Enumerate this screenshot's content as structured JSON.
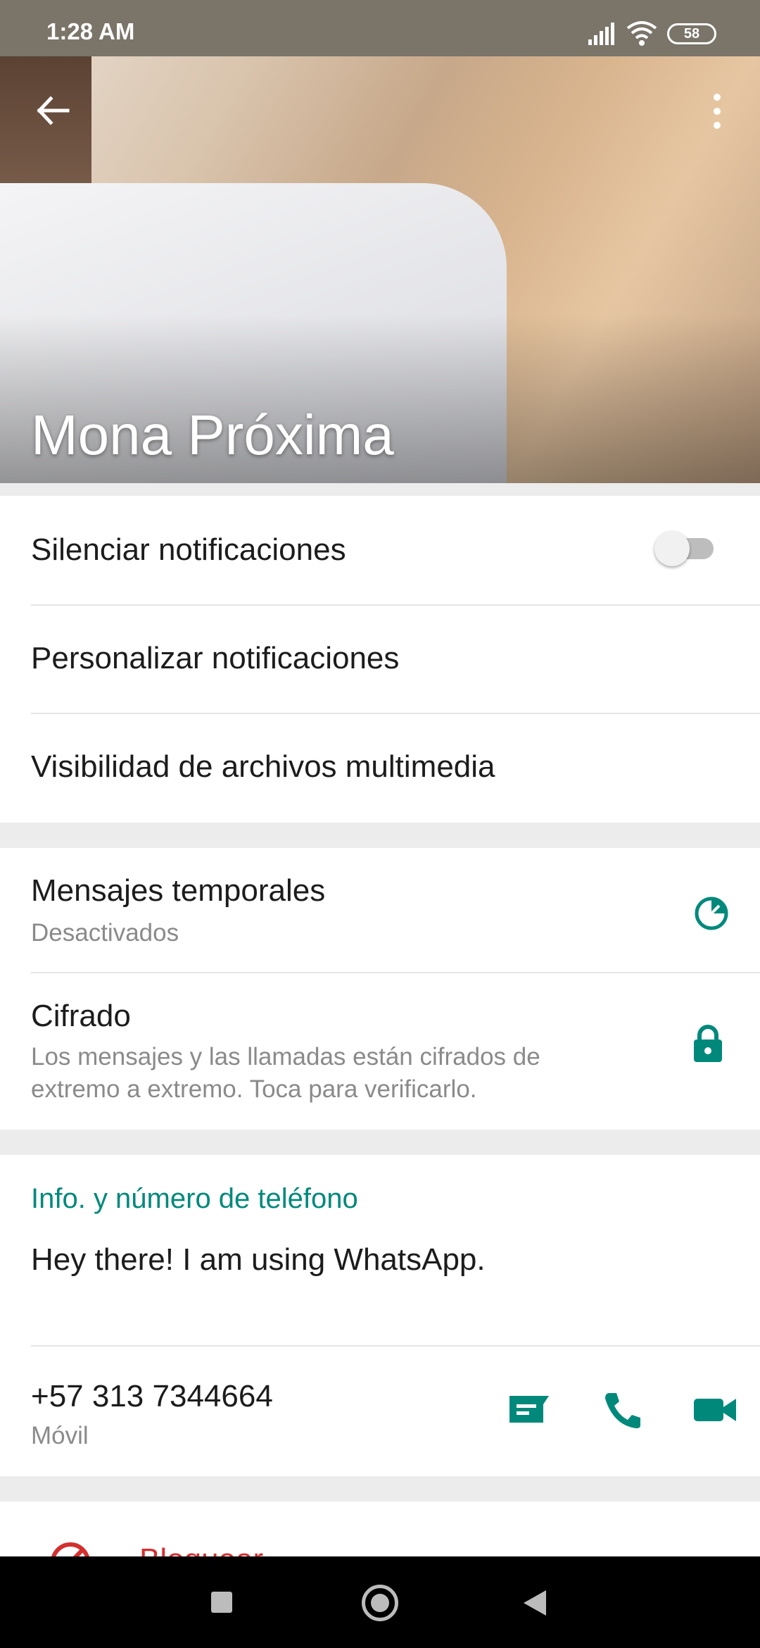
{
  "status_bar": {
    "time": "1:28 AM",
    "battery": "58"
  },
  "header": {
    "contact_name": "Mona Próxima",
    "back_icon": "arrow-left-icon",
    "menu_icon": "more-vert-icon"
  },
  "settings": {
    "mute_notifications": {
      "label": "Silenciar notificaciones",
      "enabled": false
    },
    "custom_notifications": {
      "label": "Personalizar notificaciones"
    },
    "media_visibility": {
      "label": "Visibilidad de archivos multimedia"
    }
  },
  "privacy": {
    "disappearing": {
      "label": "Mensajes temporales",
      "status": "Desactivados",
      "icon": "timer-icon"
    },
    "encryption": {
      "label": "Cifrado",
      "line1": "Los mensajes y las llamadas están cifrados de",
      "line2": "extremo a extremo. Toca para verificarlo.",
      "icon": "lock-icon"
    }
  },
  "info": {
    "section_label": "Info. y número de teléfono",
    "about": "Hey there! I am using WhatsApp.",
    "phone": "+57 313 7344664",
    "phone_type": "Móvil",
    "actions": [
      "message-icon",
      "call-icon",
      "video-call-icon"
    ]
  },
  "block": {
    "label": "Bloquear"
  },
  "colors": {
    "accent": "#00897b",
    "danger": "#d32f2f"
  }
}
